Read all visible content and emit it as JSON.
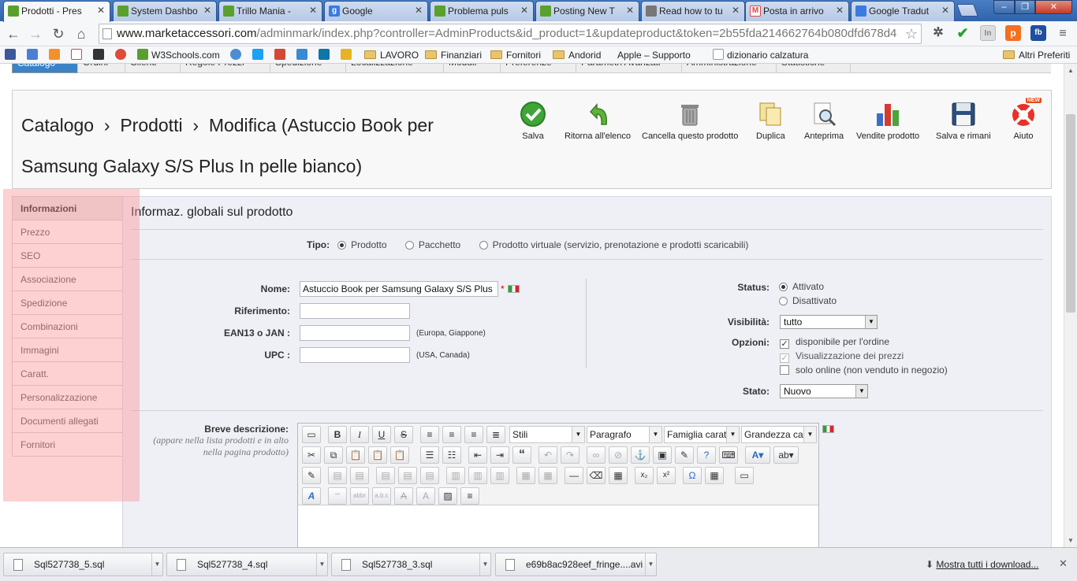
{
  "tabs": [
    {
      "label": "Prodotti - Pres",
      "active": true,
      "color": "#5aa02c"
    },
    {
      "label": "System Dashbo",
      "color": "#5aa02c"
    },
    {
      "label": "Trillo Mania -",
      "color": "#5aa02c"
    },
    {
      "label": "Google",
      "color": "#3b7be0"
    },
    {
      "label": "Problema puls",
      "color": "#5aa02c"
    },
    {
      "label": "Posting New T",
      "color": "#5aa02c"
    },
    {
      "label": "Read how to tu",
      "color": "#777777"
    },
    {
      "label": "Posta in arrivo",
      "color": "#d44"
    },
    {
      "label": "Google Tradut",
      "color": "#3b7be0"
    }
  ],
  "browser": {
    "url_host": "www.marketaccessori.com",
    "url_path": "/adminmark/index.php?controller=AdminProducts&id_product=1&updateproduct&token=2b55fda214662764b080dfd678d4",
    "window_controls": [
      "–",
      "❐",
      "✕"
    ]
  },
  "bookmarks": [
    {
      "label": "W3Schools.com",
      "type": "site",
      "color": "#5a9e2e"
    },
    {
      "label": "LAVORO",
      "type": "folder"
    },
    {
      "label": "Finanziari",
      "type": "folder"
    },
    {
      "label": "Fornitori",
      "type": "folder"
    },
    {
      "label": "Andorid",
      "type": "folder"
    },
    {
      "label": "Apple – Supporto",
      "type": "site",
      "color": "#555"
    },
    {
      "label": "dizionario calzatura",
      "type": "page"
    },
    {
      "label": "Altri Preferiti",
      "type": "folder"
    }
  ],
  "admin_menu": [
    "Catalogo",
    "Ordini",
    "Clienti",
    "Regole Prezzi",
    "Spedizione",
    "Localizzazione",
    "Moduli",
    "Preferenze",
    "Parametri Avanzati",
    "Amministrazione",
    "Statistiche"
  ],
  "header": {
    "breadcrumb_1": "Catalogo",
    "breadcrumb_2": "Prodotti",
    "breadcrumb_3": "Modifica (Astuccio Book per Samsung Galaxy S/S Plus In pelle bianco)",
    "sep": "›",
    "buttons": [
      {
        "label": "Salva",
        "icon": "check-circle-icon"
      },
      {
        "label": "Ritorna all'elenco",
        "icon": "back-arrow-icon"
      },
      {
        "label": "Cancella questo prodotto",
        "icon": "trash-icon"
      },
      {
        "label": "Duplica",
        "icon": "duplicate-icon"
      },
      {
        "label": "Anteprima",
        "icon": "magnifier-icon"
      },
      {
        "label": "Vendite prodotto",
        "icon": "bar-chart-icon"
      },
      {
        "label": "Salva e rimani",
        "icon": "floppy-icon"
      },
      {
        "label": "Aiuto",
        "icon": "lifebuoy-icon",
        "badge": "NEW"
      }
    ]
  },
  "sidenav": [
    "Informazioni",
    "Prezzo",
    "SEO",
    "Associazione",
    "Spedizione",
    "Combinazioni",
    "Immagini",
    "Caratt.",
    "Personalizzazione",
    "Documenti allegati",
    "Fornitori"
  ],
  "form": {
    "section_title": "Informaz. globali sul prodotto",
    "tipo_label": "Tipo:",
    "tipo_options": [
      "Prodotto",
      "Pacchetto",
      "Prodotto virtuale (servizio, prenotazione e prodotti scaricabili)"
    ],
    "tipo_selected": "Prodotto",
    "nome_label": "Nome:",
    "nome_value": "Astuccio Book per Samsung Galaxy S/S Plus",
    "required_mark": "*",
    "riferimento_label": "Riferimento:",
    "ean_label": "EAN13 o JAN :",
    "ean_hint": "(Europa, Giappone)",
    "upc_label": "UPC :",
    "upc_hint": "(USA, Canada)",
    "status_label": "Status:",
    "status_on": "Attivato",
    "status_off": "Disattivato",
    "visibilita_label": "Visibilità:",
    "visibilita_value": "tutto",
    "opzioni_label": "Opzioni:",
    "opzioni": [
      {
        "label": "disponibile per l'ordine",
        "checked": true,
        "disabled": false
      },
      {
        "label": "Visualizzazione dei prezzi",
        "checked": true,
        "disabled": true
      },
      {
        "label": "solo online (non venduto in negozio)",
        "checked": false,
        "disabled": false
      }
    ],
    "stato_label": "Stato:",
    "stato_value": "Nuovo",
    "breve_label": "Breve descrizione:",
    "breve_hint": "(appare nella lista prodotti e in alto nella pagina prodotto)"
  },
  "editor": {
    "stili": "Stili",
    "paragrafo": "Paragrafo",
    "famiglia": "Famiglia caratte",
    "grandezza": "Grandezza cara"
  },
  "downloads": [
    {
      "label": "Sql527738_5.sql"
    },
    {
      "label": "Sql527738_4.sql"
    },
    {
      "label": "Sql527738_3.sql"
    },
    {
      "label": "e69b8ac928eef_fringe....avi"
    }
  ],
  "downloads_show_all": "Mostra tutti i download..."
}
